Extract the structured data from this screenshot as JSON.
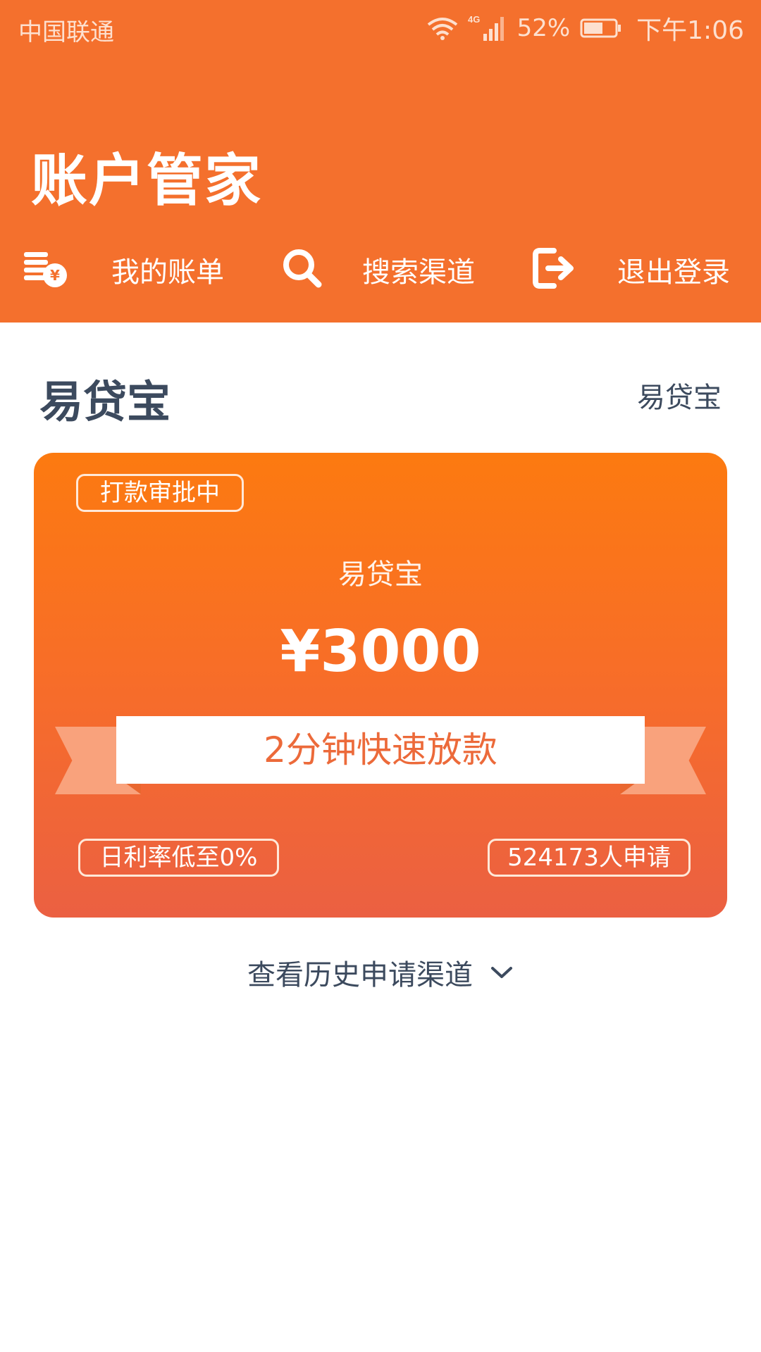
{
  "status_bar": {
    "carrier": "中国联通",
    "network": "4G",
    "battery_percent": "52%",
    "time": "下午1:06"
  },
  "header": {
    "title": "账户管家",
    "nav": [
      {
        "label": "我的账单",
        "icon": "coins-icon"
      },
      {
        "label": "搜索渠道",
        "icon": "search-icon"
      },
      {
        "label": "退出登录",
        "icon": "logout-icon"
      }
    ]
  },
  "section": {
    "title": "易贷宝",
    "right_label": "易贷宝"
  },
  "card": {
    "status_tag": "打款审批中",
    "name": "易贷宝",
    "amount": "¥3000",
    "ribbon_text": "2分钟快速放款",
    "rate_tag": "日利率低至0%",
    "apply_tag": "524173人申请",
    "colors": {
      "top": "#fc7a10",
      "bottom": "#eb6042"
    }
  },
  "history": {
    "label": "查看历史申请渠道",
    "icon": "chevron-down-icon"
  },
  "colors": {
    "header_bg": "#f4702d",
    "text_dark": "#3c4a5e",
    "ribbon_text": "#ec6a3a"
  }
}
